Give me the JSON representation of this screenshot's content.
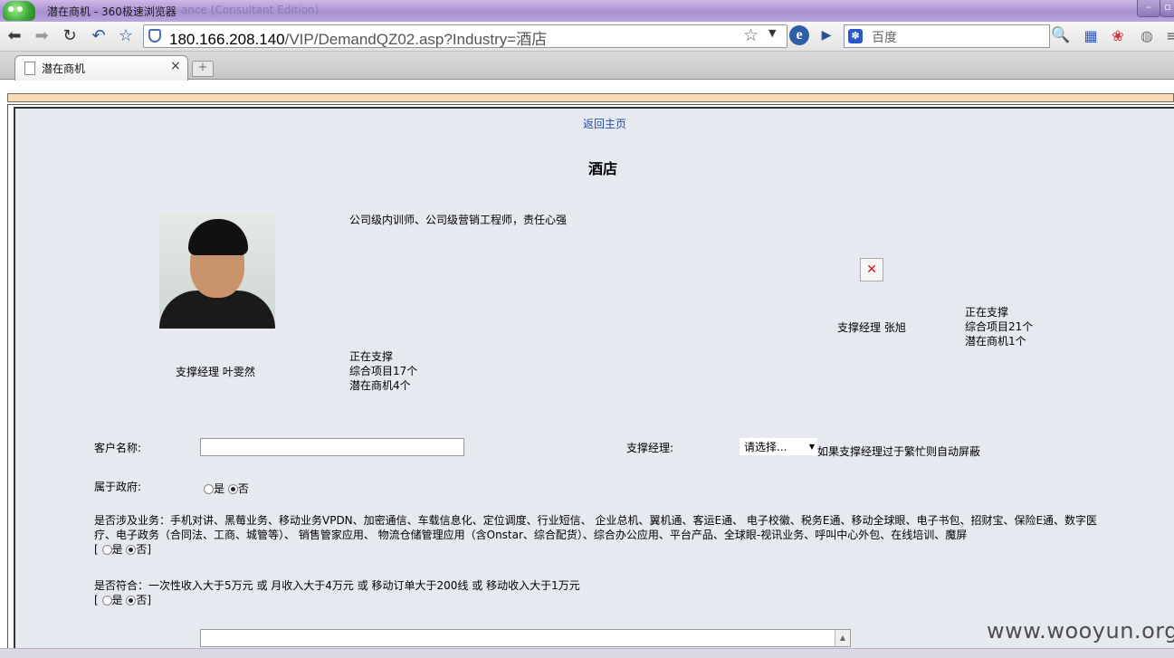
{
  "window": {
    "title": "潜在商机 - 360极速浏览器",
    "ghost_text": "ance (Consultant Edition)"
  },
  "toolbar": {
    "url_host": "180.166.208.140",
    "url_path": "/VIP/DemandQZ02.asp?Industry=酒店",
    "search_placeholder": "百度"
  },
  "tab": {
    "label": "潜在商机"
  },
  "page": {
    "home_link": "返回主页",
    "title": "酒店",
    "manager1": {
      "desc": "公司级内训师、公司级营销工程师，责任心强",
      "name": "支撑经理 叶雯然",
      "status": "正在支撑",
      "projects": "综合项目17个",
      "leads": "潜在商机4个"
    },
    "manager2": {
      "name": "支撑经理 张旭",
      "status": "正在支撑",
      "projects": "综合项目21个",
      "leads": "潜在商机1个"
    },
    "form": {
      "customer_label": "客户名称:",
      "customer_value": "",
      "manager_label": "支撑经理:",
      "manager_selected": "请选择...",
      "manager_note": "如果支撑经理过于繁忙则自动屏蔽",
      "gov_label": "属于政府:",
      "gov_yes": "是",
      "gov_no": "否",
      "gov_selected": "否",
      "biz_line1": "是否涉及业务：手机对讲、黑莓业务、移动业务VPDN、加密通信、车载信息化、定位调度、行业短信、 企业总机、翼机通、客运E通、 电子校徽、税务E通、移动全球眼、电子书包、招财宝、保险E通、数字医",
      "biz_line2": "疗、电子政务（合同法、工商、城管等）、 销售管家应用、 物流仓储管理应用（含Onstar、综合配货）、综合办公应用、平台产品、全球眼-视讯业务、呼叫中心外包、在线培训、魔屏",
      "biz_yes": "是",
      "biz_no": "否",
      "biz_selected": "否",
      "income_label": "是否符合：一次性收入大于5万元 或 月收入大于4万元 或 移动订单大于200线 或 移动收入大于1万元",
      "income_yes": "是",
      "income_no": "否",
      "income_selected": "否",
      "bracket_open": "[",
      "bracket_close": "]"
    }
  },
  "watermark": "www.wooyun.org"
}
